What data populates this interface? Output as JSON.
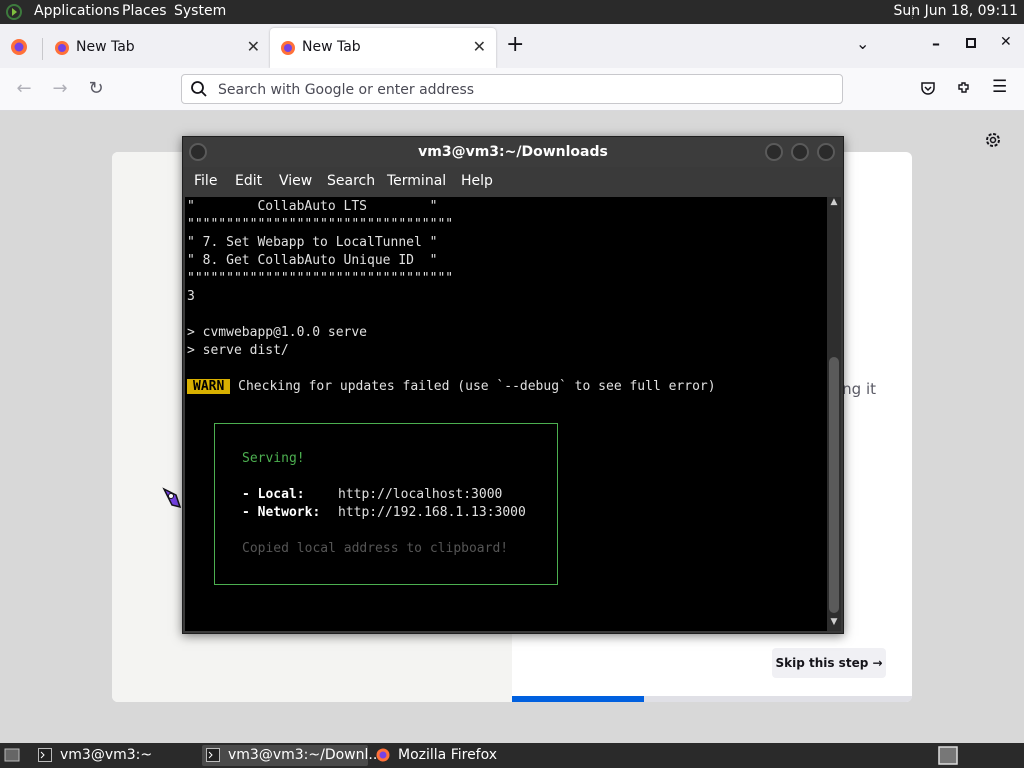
{
  "top_panel": {
    "menus": [
      "Applications",
      "Places",
      "System"
    ],
    "clock": "Sun Jun 18, 09:11"
  },
  "browser": {
    "tabs": [
      {
        "label": "New Tab",
        "active": false
      },
      {
        "label": "New Tab",
        "active": true
      }
    ],
    "url_placeholder": "Search with Google or enter address",
    "page": {
      "partial_text": "ing it",
      "skip_button": "Skip this step →",
      "progress": 0.33
    }
  },
  "terminal": {
    "title": "vm3@vm3:~/Downloads",
    "menu": [
      "File",
      "Edit",
      "View",
      "Search",
      "Terminal",
      "Help"
    ],
    "lines": [
      "\"        CollabAuto LTS        \"",
      "\"\"\"\"\"\"\"\"\"\"\"\"\"\"\"\"\"\"\"\"\"\"\"\"\"\"\"\"\"\"\"\"\"\"",
      "\" 7. Set Webapp to LocalTunnel \"",
      "\" 8. Get CollabAuto Unique ID  \"",
      "\"\"\"\"\"\"\"\"\"\"\"\"\"\"\"\"\"\"\"\"\"\"\"\"\"\"\"\"\"\"\"\"\"\"",
      "3",
      "",
      "> cvmwebapp@1.0.0 serve",
      "> serve dist/"
    ],
    "warn_badge": "WARN",
    "warn_text": " Checking for updates failed (use `--debug` to see full error)",
    "serve_box": {
      "serving": "Serving!",
      "local_label": "- Local:",
      "local_url": "http://localhost:3000",
      "network_label": "- Network:",
      "network_url": "http://192.168.1.13:3000",
      "copied": "Copied local address to clipboard!"
    }
  },
  "taskbar": {
    "items": [
      {
        "label": "vm3@vm3:~",
        "active": false
      },
      {
        "label": "vm3@vm3:~/Downl...",
        "active": true
      },
      {
        "label": "Mozilla Firefox",
        "active": false
      }
    ]
  }
}
